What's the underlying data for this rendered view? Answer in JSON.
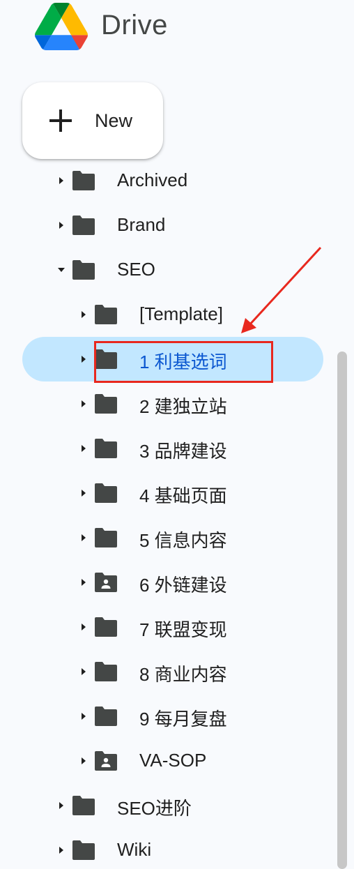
{
  "app": {
    "name": "Drive"
  },
  "new_button": {
    "label": "New"
  },
  "tree": {
    "items": [
      {
        "label": "Archived",
        "level": 1,
        "expanded": false,
        "icon": "folder-icon"
      },
      {
        "label": "Brand",
        "level": 1,
        "expanded": false,
        "icon": "folder-icon"
      },
      {
        "label": "SEO",
        "level": 1,
        "expanded": true,
        "icon": "folder-icon"
      },
      {
        "label": "[Template]",
        "level": 2,
        "expanded": false,
        "icon": "folder-icon"
      },
      {
        "label": "1 利基选词",
        "level": 2,
        "expanded": false,
        "icon": "folder-icon",
        "selected": true
      },
      {
        "label": "2 建独立站",
        "level": 2,
        "expanded": false,
        "icon": "folder-icon"
      },
      {
        "label": "3 品牌建设",
        "level": 2,
        "expanded": false,
        "icon": "folder-icon"
      },
      {
        "label": "4 基础页面",
        "level": 2,
        "expanded": false,
        "icon": "folder-icon"
      },
      {
        "label": "5 信息内容",
        "level": 2,
        "expanded": false,
        "icon": "folder-icon"
      },
      {
        "label": "6 外链建设",
        "level": 2,
        "expanded": false,
        "icon": "shared-folder-icon"
      },
      {
        "label": "7 联盟变现",
        "level": 2,
        "expanded": false,
        "icon": "folder-icon"
      },
      {
        "label": "8 商业内容",
        "level": 2,
        "expanded": false,
        "icon": "folder-icon"
      },
      {
        "label": "9 每月复盘",
        "level": 2,
        "expanded": false,
        "icon": "folder-icon"
      },
      {
        "label": "VA-SOP",
        "level": 2,
        "expanded": false,
        "icon": "shared-folder-icon"
      },
      {
        "label": "SEO进阶",
        "level": 1,
        "expanded": false,
        "icon": "folder-icon"
      },
      {
        "label": "Wiki",
        "level": 1,
        "expanded": false,
        "icon": "folder-icon"
      }
    ]
  },
  "colors": {
    "background": "#f8fafd",
    "selected_bg": "#c2e7ff",
    "selected_text": "#0b57d0",
    "icon": "#444746",
    "annotation": "#e8281e"
  }
}
